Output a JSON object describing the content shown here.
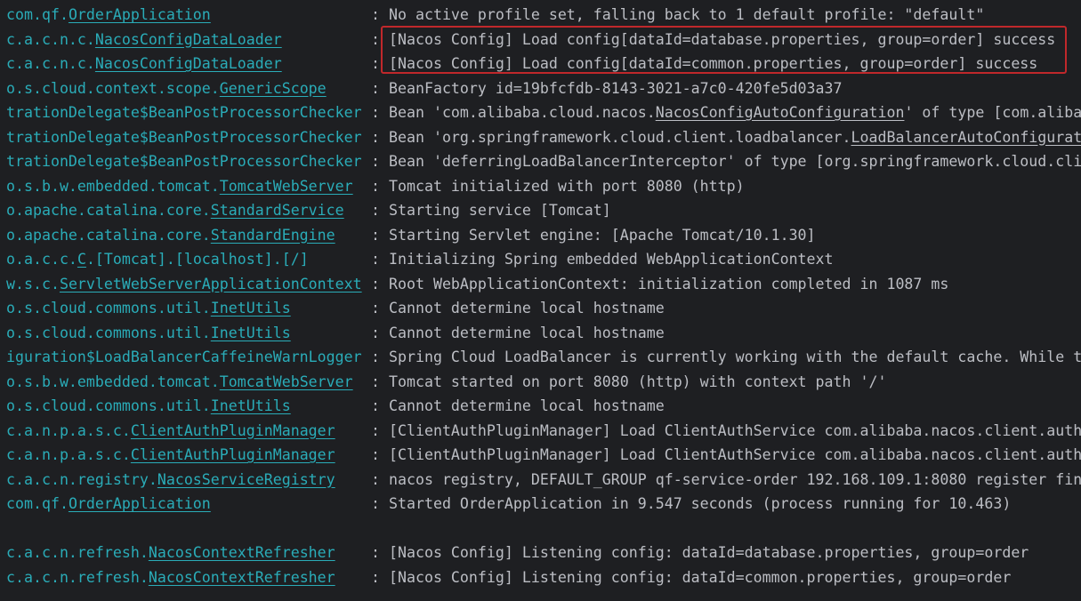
{
  "highlight_color": "#c0282b",
  "logger_color": "#2aacb8",
  "text_color": "#bcbec4",
  "background_color": "#1e1f22",
  "separator": ":",
  "lines": [
    {
      "logger_prefix": "com.qf.",
      "logger_class": "OrderApplication",
      "message_pre": "No active profile set, falling back to 1 default profile: \"default\"",
      "message_link": "",
      "message_post": ""
    },
    {
      "logger_prefix": "c.a.c.n.c.",
      "logger_class": "NacosConfigDataLoader",
      "message_pre": "[Nacos Config] Load config[dataId=database.properties, group=order] success",
      "message_link": "",
      "message_post": ""
    },
    {
      "logger_prefix": "c.a.c.n.c.",
      "logger_class": "NacosConfigDataLoader",
      "message_pre": "[Nacos Config] Load config[dataId=common.properties, group=order] success",
      "message_link": "",
      "message_post": ""
    },
    {
      "logger_prefix": "o.s.cloud.context.scope.",
      "logger_class": "GenericScope",
      "message_pre": "BeanFactory id=19bfcfdb-8143-3021-a7c0-420fe5d03a37",
      "message_link": "",
      "message_post": ""
    },
    {
      "logger_prefix": "trationDelegate$BeanPostProcessorChecker",
      "logger_class": "",
      "message_pre": "Bean 'com.alibaba.cloud.nacos.",
      "message_link": "NacosConfigAutoConfiguration",
      "message_post": "' of type [com.aliba"
    },
    {
      "logger_prefix": "trationDelegate$BeanPostProcessorChecker",
      "logger_class": "",
      "message_pre": "Bean 'org.springframework.cloud.client.loadbalancer.",
      "message_link": "LoadBalancerAutoConfigurat",
      "message_post": ""
    },
    {
      "logger_prefix": "trationDelegate$BeanPostProcessorChecker",
      "logger_class": "",
      "message_pre": "Bean 'deferringLoadBalancerInterceptor' of type [org.springframework.cloud.cli",
      "message_link": "",
      "message_post": ""
    },
    {
      "logger_prefix": "o.s.b.w.embedded.tomcat.",
      "logger_class": "TomcatWebServer",
      "message_pre": "Tomcat initialized with port 8080 (http)",
      "message_link": "",
      "message_post": ""
    },
    {
      "logger_prefix": "o.apache.catalina.core.",
      "logger_class": "StandardService",
      "message_pre": "Starting service [Tomcat]",
      "message_link": "",
      "message_post": ""
    },
    {
      "logger_prefix": "o.apache.catalina.core.",
      "logger_class": "StandardEngine",
      "message_pre": "Starting Servlet engine: [Apache Tomcat/10.1.30]",
      "message_link": "",
      "message_post": ""
    },
    {
      "logger_prefix": "o.a.c.c.",
      "logger_class": "C",
      "logger_suffix": ".[Tomcat].[localhost].[/]",
      "message_pre": "Initializing Spring embedded WebApplicationContext",
      "message_link": "",
      "message_post": ""
    },
    {
      "logger_prefix": "w.s.c.",
      "logger_class": "ServletWebServerApplicationContext",
      "message_pre": "Root WebApplicationContext: initialization completed in 1087 ms",
      "message_link": "",
      "message_post": ""
    },
    {
      "logger_prefix": "o.s.cloud.commons.util.",
      "logger_class": "InetUtils",
      "message_pre": "Cannot determine local hostname",
      "message_link": "",
      "message_post": ""
    },
    {
      "logger_prefix": "o.s.cloud.commons.util.",
      "logger_class": "InetUtils",
      "message_pre": "Cannot determine local hostname",
      "message_link": "",
      "message_post": ""
    },
    {
      "logger_prefix": "iguration$LoadBalancerCaffeineWarnLogger",
      "logger_class": "",
      "message_pre": "Spring Cloud LoadBalancer is currently working with the default cache. While t",
      "message_link": "",
      "message_post": ""
    },
    {
      "logger_prefix": "o.s.b.w.embedded.tomcat.",
      "logger_class": "TomcatWebServer",
      "message_pre": "Tomcat started on port 8080 (http) with context path '/'",
      "message_link": "",
      "message_post": ""
    },
    {
      "logger_prefix": "o.s.cloud.commons.util.",
      "logger_class": "InetUtils",
      "message_pre": "Cannot determine local hostname",
      "message_link": "",
      "message_post": ""
    },
    {
      "logger_prefix": "c.a.n.p.a.s.c.",
      "logger_class": "ClientAuthPluginManager",
      "message_pre": "[ClientAuthPluginManager] Load ClientAuthService com.alibaba.nacos.client.auth",
      "message_link": "",
      "message_post": ""
    },
    {
      "logger_prefix": "c.a.n.p.a.s.c.",
      "logger_class": "ClientAuthPluginManager",
      "message_pre": "[ClientAuthPluginManager] Load ClientAuthService com.alibaba.nacos.client.auth",
      "message_link": "",
      "message_post": ""
    },
    {
      "logger_prefix": "c.a.c.n.registry.",
      "logger_class": "NacosServiceRegistry",
      "message_pre": "nacos registry, DEFAULT_GROUP qf-service-order 192.168.109.1:8080 register fin",
      "message_link": "",
      "message_post": ""
    },
    {
      "logger_prefix": "com.qf.",
      "logger_class": "OrderApplication",
      "message_pre": "Started OrderApplication in 9.547 seconds (process running for 10.463)",
      "message_link": "",
      "message_post": ""
    },
    {
      "blank": true
    },
    {
      "logger_prefix": "c.a.c.n.refresh.",
      "logger_class": "NacosContextRefresher",
      "message_pre": "[Nacos Config] Listening config: dataId=database.properties, group=order",
      "message_link": "",
      "message_post": ""
    },
    {
      "logger_prefix": "c.a.c.n.refresh.",
      "logger_class": "NacosContextRefresher",
      "message_pre": "[Nacos Config] Listening config: dataId=common.properties, group=order",
      "message_link": "",
      "message_post": ""
    }
  ]
}
